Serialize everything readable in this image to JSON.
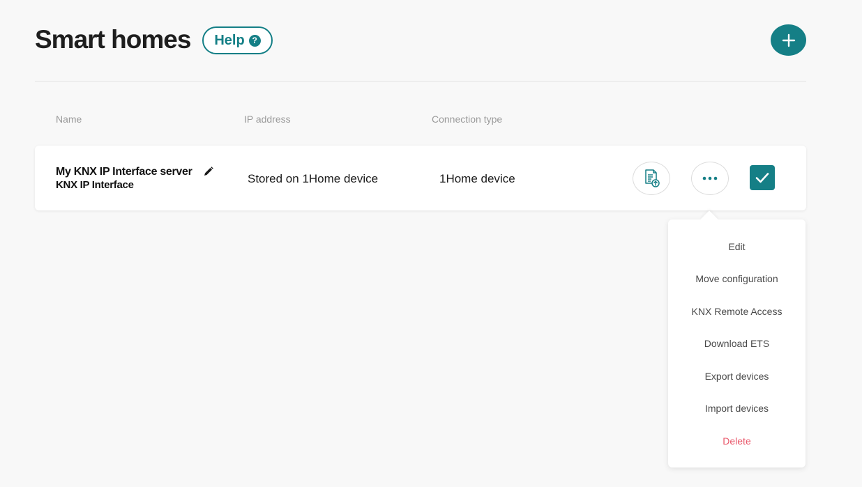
{
  "header": {
    "title": "Smart homes",
    "help_label": "Help",
    "help_icon": "question-circle-icon",
    "add_icon": "plus-icon"
  },
  "table": {
    "columns": [
      "Name",
      "IP address",
      "Connection type"
    ],
    "rows": [
      {
        "name": "My KNX IP Interface server",
        "subtitle": "KNX IP Interface",
        "ip": "Stored on 1Home device",
        "connection": "1Home device"
      }
    ]
  },
  "menu": {
    "items": [
      "Edit",
      "Move configuration",
      "KNX Remote Access",
      "Download ETS",
      "Export devices",
      "Import devices",
      "Delete"
    ]
  },
  "colors": {
    "accent": "#157f86",
    "danger": "#e9576a",
    "background": "#f8f8f8"
  }
}
